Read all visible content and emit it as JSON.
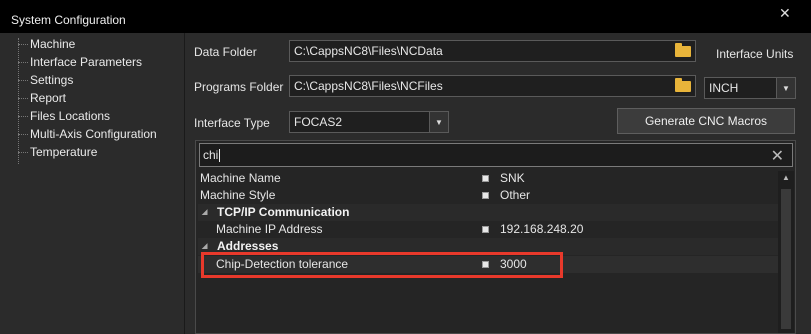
{
  "window": {
    "title": "System Configuration",
    "close_glyph": "✕"
  },
  "nav": {
    "items": [
      "Machine",
      "Interface Parameters",
      "Settings",
      "Report",
      "Files Locations",
      "Multi-Axis Configuration",
      "Temperature"
    ]
  },
  "form": {
    "data_folder_label": "Data Folder",
    "data_folder_value": "C:\\CappsNC8\\Files\\NCData",
    "programs_folder_label": "Programs Folder",
    "programs_folder_value": "C:\\CappsNC8\\Files\\NCFiles",
    "interface_units_label": "Interface Units",
    "interface_units_value": "INCH",
    "interface_type_label": "Interface Type",
    "interface_type_value": "FOCAS2",
    "generate_button": "Generate CNC Macros"
  },
  "grid": {
    "search_value": "chi",
    "rows": [
      {
        "name": "Machine Name",
        "value": "SNK"
      },
      {
        "name": "Machine Style",
        "value": "Other"
      }
    ],
    "cat1": "TCP/IP Communication",
    "cat1_rows": [
      {
        "name": "Machine IP Address",
        "value": "192.168.248.20"
      }
    ],
    "cat2": "Addresses",
    "cat2_rows": [
      {
        "name": "Chip-Detection tolerance",
        "value": "3000"
      }
    ]
  },
  "colors": {
    "highlight": "#e8392b",
    "folder": "#e8b43a"
  }
}
